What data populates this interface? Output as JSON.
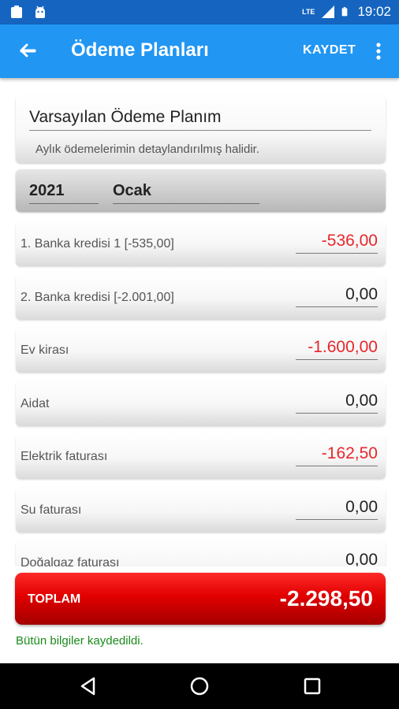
{
  "status_bar": {
    "time": "19:02",
    "network_label": "LTE",
    "left_icons": [
      "notification-clipboard-icon",
      "android-icon"
    ],
    "right_icons": [
      "signal-icon",
      "battery-icon"
    ]
  },
  "app_bar": {
    "title": "Ödeme Planları",
    "save_label": "KAYDET",
    "back_icon": "arrow-left-icon",
    "more_icon": "more-vert-icon",
    "color": "#2196f3"
  },
  "plan": {
    "name": "Varsayılan Ödeme Planım",
    "description": "Aylık ödemelerimin detaylandırılmış halidir."
  },
  "period": {
    "year": "2021",
    "month": "Ocak"
  },
  "payments": [
    {
      "label": "1. Banka kredisi 1 [-535,00]",
      "amount": "-536,00",
      "negative": true
    },
    {
      "label": "2. Banka kredisi [-2.001,00]",
      "amount": "0,00",
      "negative": false
    },
    {
      "label": "Ev kirası",
      "amount": "-1.600,00",
      "negative": true
    },
    {
      "label": "Aidat",
      "amount": "0,00",
      "negative": false
    },
    {
      "label": "Elektrik faturası",
      "amount": "-162,50",
      "negative": true
    },
    {
      "label": "Su faturası",
      "amount": "0,00",
      "negative": false
    },
    {
      "label": "Doğalgaz faturası",
      "amount": "0,00",
      "negative": false
    }
  ],
  "total": {
    "label": "TOPLAM",
    "value": "-2.298,50",
    "color": "#e10000"
  },
  "status_message": "Bütün bilgiler kaydedildi.",
  "colors": {
    "negative_amount": "#e8262b",
    "success_text": "#1a8a1a"
  }
}
